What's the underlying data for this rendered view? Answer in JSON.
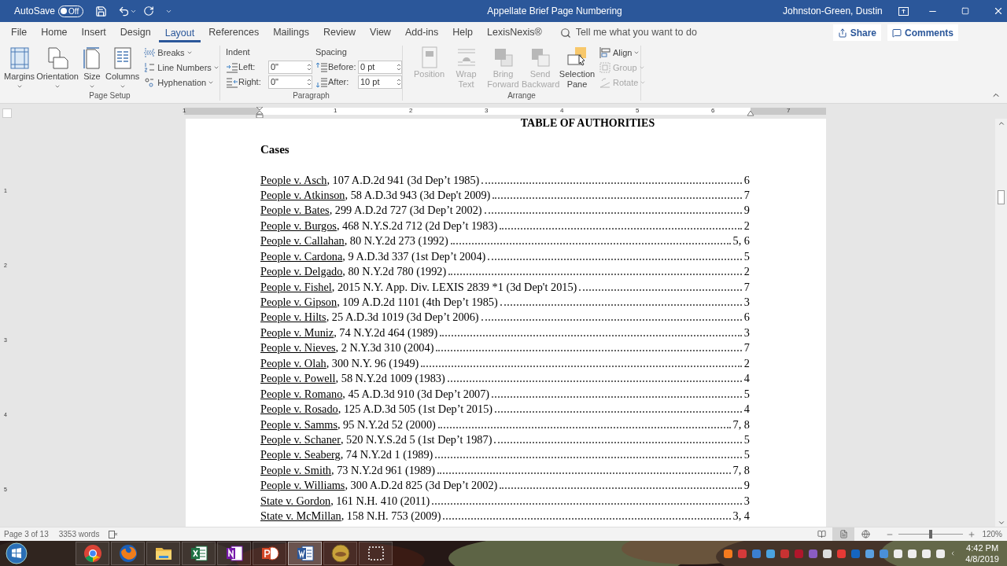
{
  "title_bar": {
    "autosave_label": "AutoSave",
    "autosave": {
      "on": false,
      "label": "Off"
    },
    "title": "Appellate Brief Page Numbering",
    "user": "Johnston-Green, Dustin"
  },
  "menu_tabs": [
    {
      "label": "File",
      "selected": false
    },
    {
      "label": "Home",
      "selected": false
    },
    {
      "label": "Insert",
      "selected": false
    },
    {
      "label": "Design",
      "selected": false
    },
    {
      "label": "Layout",
      "selected": true
    },
    {
      "label": "References",
      "selected": false
    },
    {
      "label": "Mailings",
      "selected": false
    },
    {
      "label": "Review",
      "selected": false
    },
    {
      "label": "View",
      "selected": false
    },
    {
      "label": "Add-ins",
      "selected": false
    },
    {
      "label": "Help",
      "selected": false
    },
    {
      "label": "LexisNexis®",
      "selected": false
    }
  ],
  "tell_me": {
    "placeholder": "Tell me what you want to do"
  },
  "share": "Share",
  "comments": "Comments",
  "ribbon": {
    "page_setup": {
      "label": "Page Setup",
      "large": [
        {
          "kind": "margins",
          "label": "Margins"
        },
        {
          "kind": "orientation",
          "label": "Orientation"
        },
        {
          "kind": "size",
          "label": "Size"
        },
        {
          "kind": "columns",
          "label": "Columns"
        }
      ],
      "small": [
        {
          "kind": "breaks",
          "label": "Breaks"
        },
        {
          "kind": "line-numbers",
          "label": "Line Numbers"
        },
        {
          "kind": "hyphenation",
          "label": "Hyphenation"
        }
      ]
    },
    "paragraph": {
      "label": "Paragraph",
      "indent_label": "Indent",
      "spacing_label": "Spacing",
      "indent": [
        {
          "kind": "left",
          "label": "Left:",
          "value": "0\""
        },
        {
          "kind": "right",
          "label": "Right:",
          "value": "0\""
        }
      ],
      "spacing": [
        {
          "kind": "before",
          "label": "Before:",
          "value": "0 pt"
        },
        {
          "kind": "after",
          "label": "After:",
          "value": "10 pt"
        }
      ]
    },
    "arrange": {
      "label": "Arrange",
      "large": [
        {
          "kind": "position",
          "label": "Position",
          "disabled": true
        },
        {
          "kind": "wrap",
          "label": "Wrap Text",
          "disabled": true
        },
        {
          "kind": "bring",
          "label": "Bring Forward",
          "disabled": true
        },
        {
          "kind": "send",
          "label": "Send Backward",
          "disabled": true
        },
        {
          "kind": "selection",
          "label": "Selection Pane",
          "disabled": false
        }
      ],
      "small": [
        {
          "kind": "align",
          "label": "Align",
          "disabled": false
        },
        {
          "kind": "group",
          "label": "Group",
          "disabled": true
        },
        {
          "kind": "rotate",
          "label": "Rotate",
          "disabled": true
        }
      ]
    }
  },
  "ruler": {
    "labels": [
      "1",
      "1",
      "2",
      "3",
      "4",
      "5",
      "6",
      "7"
    ],
    "vertical_labels": [
      "1",
      "2",
      "3",
      "4",
      "5"
    ]
  },
  "document": {
    "title": "TABLE OF AUTHORITIES",
    "heading": "Cases",
    "entries": [
      {
        "case": "People v. Asch",
        "citation": ", 107 A.D.2d 941 (3d Dep’t 1985)",
        "pages": "6"
      },
      {
        "case": "People v. Atkinson",
        "citation": ", 58 A.D.3d 943 (3d Dep't 2009)",
        "pages": "7"
      },
      {
        "case": "People v. Bates",
        "citation": ", 299 A.D.2d 727 (3d Dep’t 2002)",
        "pages": "9"
      },
      {
        "case": "People v. Burgos",
        "citation": ", 468 N.Y.S.2d 712 (2d Dep’t 1983)",
        "pages": "2"
      },
      {
        "case": "People v. Callahan",
        "citation": ", 80 N.Y.2d 273 (1992)",
        "pages": "5, 6"
      },
      {
        "case": "People v. Cardona",
        "citation": ", 9 A.D.3d 337 (1st Dep’t 2004)",
        "pages": "5"
      },
      {
        "case": "People v. Delgado",
        "citation": ", 80 N.Y.2d 780 (1992)",
        "pages": "2"
      },
      {
        "case": "People v. Fishel",
        "citation": ", 2015 N.Y. App. Div. LEXIS 2839 *1 (3d Dep't 2015)",
        "pages": "7"
      },
      {
        "case": "People v. Gipson",
        "citation": ", 109 A.D.2d 1101 (4th Dep’t 1985)",
        "pages": "3"
      },
      {
        "case": "People v. Hilts",
        "citation": ", 25 A.D.3d 1019 (3d Dep’t 2006)",
        "pages": "6"
      },
      {
        "case": "People v. Muniz",
        "citation": ", 74 N.Y.2d 464 (1989)",
        "pages": "3"
      },
      {
        "case": "People v. Nieves",
        "citation": ", 2 N.Y.3d 310 (2004)",
        "pages": "7"
      },
      {
        "case": "People v. Olah",
        "citation": ", 300 N.Y. 96 (1949)",
        "pages": "2"
      },
      {
        "case": "People v. Powell",
        "citation": ", 58 N.Y.2d 1009 (1983)",
        "pages": "4"
      },
      {
        "case": "People v. Romano",
        "citation": ", 45 A.D.3d 910 (3d Dep’t 2007)",
        "pages": "5"
      },
      {
        "case": "People v. Rosado",
        "citation": ", 125 A.D.3d 505 (1st Dep’t 2015)",
        "pages": "4"
      },
      {
        "case": "People v. Samms",
        "citation": ", 95 N.Y.2d 52 (2000)",
        "pages": "7, 8"
      },
      {
        "case": "People v. Schaner",
        "citation": ", 520 N.Y.S.2d 5 (1st Dep’t 1987)",
        "pages": "5"
      },
      {
        "case": "People v. Seaberg",
        "citation": ", 74 N.Y.2d 1 (1989)",
        "pages": "5"
      },
      {
        "case": "People v. Smith",
        "citation": ", 73 N.Y.2d 961 (1989)",
        "pages": "7, 8"
      },
      {
        "case": "People v. Williams",
        "citation": ", 300 A.D.2d 825 (3d Dep’t 2002)",
        "pages": "9"
      },
      {
        "case": "State v. Gordon",
        "citation": ", 161 N.H. 410 (2011)",
        "pages": "3"
      },
      {
        "case": "State v. McMillan",
        "citation": ", 158 N.H. 753 (2009)",
        "pages": "3, 4"
      }
    ]
  },
  "status_bar": {
    "page": "Page 3 of 13",
    "words": "3353 words",
    "views": [
      {
        "kind": "read",
        "selected": false
      },
      {
        "kind": "print",
        "selected": true
      },
      {
        "kind": "web",
        "selected": false
      }
    ],
    "zoom": {
      "level": 0.5,
      "label": "120%"
    }
  },
  "taskbar": {
    "apps": [
      {
        "kind": "chrome",
        "selected": false
      },
      {
        "kind": "firefox",
        "selected": false
      },
      {
        "kind": "explorer",
        "selected": false
      },
      {
        "kind": "excel",
        "selected": false
      },
      {
        "kind": "onenote",
        "selected": false
      },
      {
        "kind": "powerpoint",
        "selected": false
      },
      {
        "kind": "word",
        "selected": true
      },
      {
        "kind": "orb",
        "selected": false
      },
      {
        "kind": "snip",
        "selected": false
      }
    ],
    "time": "4:42 PM",
    "date": "4/8/2019"
  }
}
